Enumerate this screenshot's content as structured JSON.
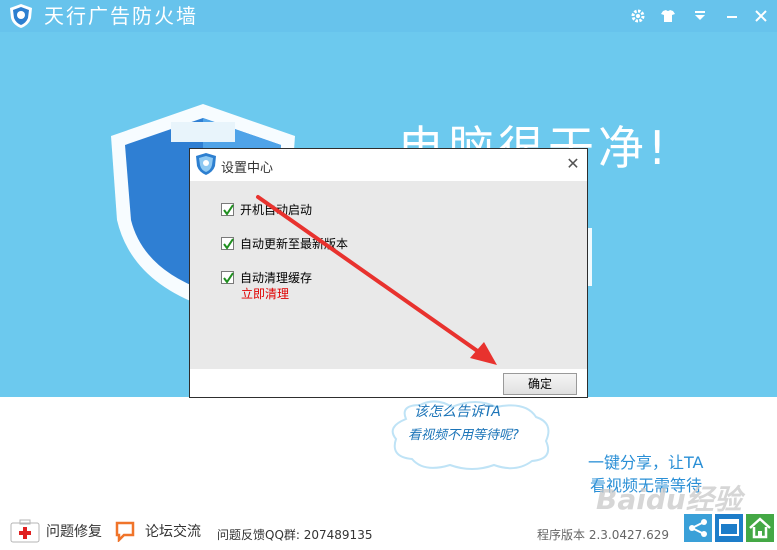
{
  "app": {
    "title": "天行广告防火墙",
    "slogan": "电脑很干净!"
  },
  "titlebar_icons": [
    "gear-icon",
    "shirt-icon",
    "dropdown-icon",
    "minimize-icon",
    "close-icon"
  ],
  "dialog": {
    "title": "设置中心",
    "options": [
      {
        "label": "开机自动启动",
        "checked": true
      },
      {
        "label": "自动更新至最新版本",
        "checked": true
      },
      {
        "label": "自动清理缓存",
        "checked": true
      }
    ],
    "clean_link": "立即清理",
    "ok_label": "确定"
  },
  "promo": {
    "cloud_line1": "该怎么告诉TA",
    "cloud_line2": "看视频不用等待呢?",
    "share_line1": "一键分享，让TA",
    "share_line2": "看视频无需等待"
  },
  "bottom": {
    "repair_label": "问题修复",
    "forum_label": "论坛交流",
    "feedback": "问题反馈QQ群: 207489135",
    "version": "程序版本 2.3.0427.629"
  },
  "watermark": "Baidu经验",
  "colors": {
    "accent": "#6cc9ee",
    "link_red": "#e00000",
    "arrow_red": "#e8322e",
    "promo_blue": "#2a8fd6"
  }
}
